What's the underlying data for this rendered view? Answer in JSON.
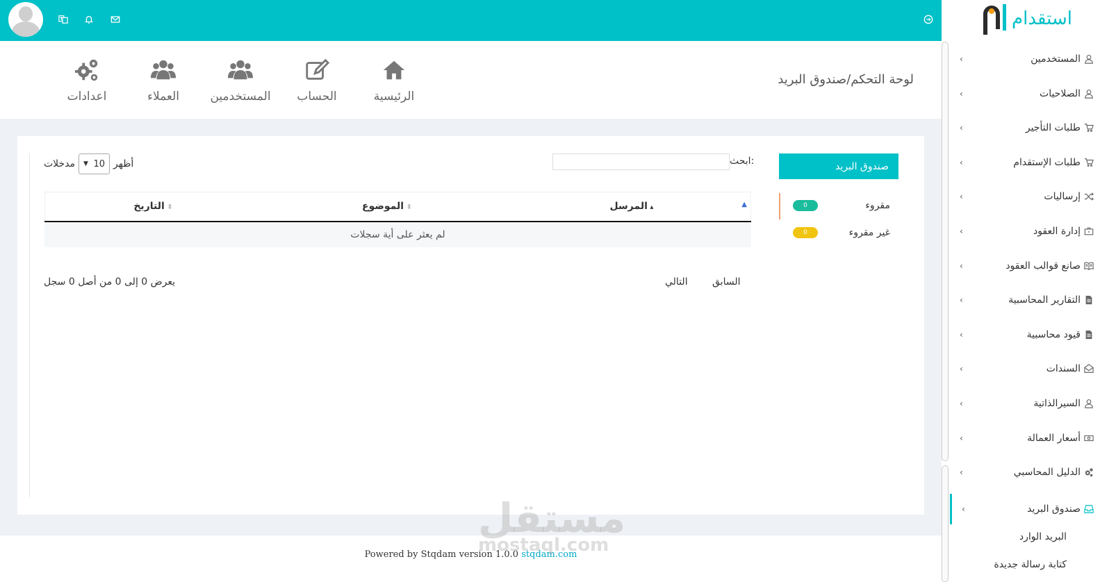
{
  "topbar": {
    "icons": [
      "translate-icon",
      "bell-icon",
      "envelope-icon",
      "logout-icon"
    ]
  },
  "sidebar": {
    "logo_text": "استقدام",
    "items": [
      {
        "label": "المستخدمين",
        "icon": "user-icon"
      },
      {
        "label": "الصلاحيات",
        "icon": "user-icon"
      },
      {
        "label": "طلبات التأجير",
        "icon": "cart-icon"
      },
      {
        "label": "طلبات الإستقدام",
        "icon": "cart-icon"
      },
      {
        "label": "إرساليات",
        "icon": "shuffle-icon"
      },
      {
        "label": "إدارة العقود",
        "icon": "briefcase-icon"
      },
      {
        "label": "صانع قوالب العقود",
        "icon": "book-icon"
      },
      {
        "label": "التقارير المحاسبية",
        "icon": "file-icon"
      },
      {
        "label": "قيود محاسبية",
        "icon": "file-icon"
      },
      {
        "label": "السندات",
        "icon": "envelope-open-icon"
      },
      {
        "label": "السيرالذاتية",
        "icon": "user-icon"
      },
      {
        "label": "أسعار العمالة",
        "icon": "money-icon"
      },
      {
        "label": "الدليل المحاسبي",
        "icon": "gears-icon"
      },
      {
        "label": "صندوق البريد",
        "icon": "inbox-icon"
      }
    ],
    "sub_items": [
      "البريد الوارد",
      "كتابة رسالة جديدة"
    ]
  },
  "header": {
    "breadcrumb": "لوحة التحكم/صندوق البريد",
    "quick_links": [
      {
        "label": "الرئيسية",
        "icon": "home-icon"
      },
      {
        "label": "الحساب",
        "icon": "edit-icon"
      },
      {
        "label": "المستخدمين",
        "icon": "users-icon"
      },
      {
        "label": "العملاء",
        "icon": "users-icon"
      },
      {
        "label": "اعدادات",
        "icon": "gears-icon"
      }
    ]
  },
  "mailbox": {
    "title": "صندوق البريد",
    "folders": [
      {
        "label": "مقروء",
        "count": "0",
        "color": "#1abc9c"
      },
      {
        "label": "غير مقروء",
        "count": "0",
        "color": "#f1c40f"
      }
    ]
  },
  "table": {
    "search_label": "ابحث:",
    "search_value": "",
    "show_label": "أظهر",
    "entries_label": "مدخلات",
    "page_length": "10",
    "columns": [
      "المرسل",
      "الموضوع",
      "التاريخ"
    ],
    "empty_message": "لم يعثر على أية سجلات",
    "info": "يعرض 0 إلى 0 من أصل 0 سجل",
    "prev_label": "السابق",
    "next_label": "التالي"
  },
  "footer": {
    "text": "Powered by Stqdam version 1.0.0",
    "link": "stqdam.com"
  },
  "watermark": {
    "arabic": "مستقل",
    "latin": "mostaql.com"
  },
  "colors": {
    "accent": "#00c0c8",
    "read_badge": "#1abc9c",
    "unread_badge": "#f1c40f"
  }
}
